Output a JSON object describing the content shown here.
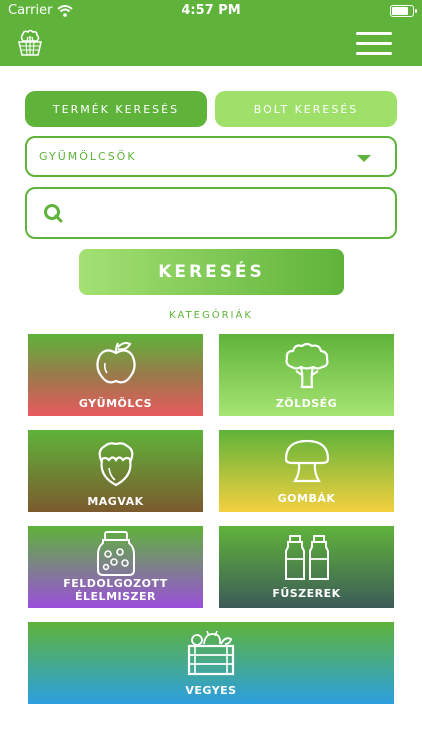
{
  "status_bar": {
    "carrier": "Carrier",
    "time": "4:57 PM"
  },
  "nav": {
    "logo_icon": "broccoli-basket-icon",
    "menu_icon": "hamburger-menu-icon"
  },
  "tabs": {
    "product": "TERMÉK KERESÉS",
    "store": "BOLT KERESÉS"
  },
  "select": {
    "value": "GYÜMÖLCSÖK"
  },
  "search": {
    "placeholder": "",
    "value": ""
  },
  "search_button": "KERESÉS",
  "categories": {
    "title": "KATEGÓRIÁK",
    "fruit": "GYÜMÖLCS",
    "vegetable": "ZÖLDSÉG",
    "nuts": "MAGVAK",
    "mushrooms": "GOMBÁK",
    "processed": "FELDOLGOZOTT ÉLELMISZER",
    "spices": "FŰSZEREK",
    "mixed": "VEGYES"
  },
  "colors": {
    "brand_green": "#5fb33a",
    "light_green": "#9ee06a",
    "fruit_bottom": "#e85a5f",
    "nuts_bottom": "#7b5a2e",
    "mushroom_bottom": "#f4d03f",
    "processed_bottom": "#9b4fdb",
    "spices_bottom": "#3d5b58",
    "mixed_bottom": "#2d9fe0"
  }
}
